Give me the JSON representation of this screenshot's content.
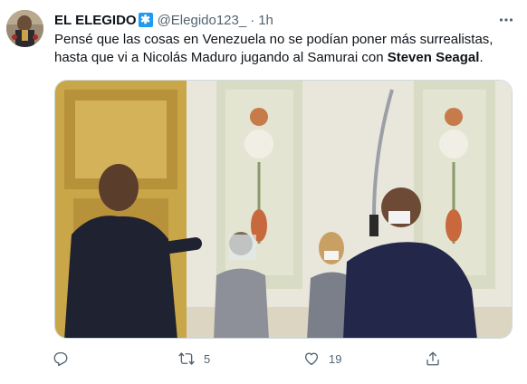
{
  "tweet": {
    "display_name": "EL ELEGIDO",
    "badge_glyph": "✱",
    "handle": "@Elegido123_",
    "separator": "·",
    "time": "1h",
    "text_part1": "Pensé que las cosas en Venezuela no se podían poner más surrealistas, hasta que vi a Nicolás Maduro jugando al Samurai con ",
    "text_bold": "Steven Seagal",
    "text_end": "."
  },
  "actions": {
    "reply_count": "",
    "retweet_count": "5",
    "like_count": "19",
    "icons": [
      "reply-icon",
      "retweet-icon",
      "like-icon",
      "share-icon"
    ]
  },
  "colors": {
    "accent": "#1d9bf0",
    "muted": "#536471",
    "text": "#0f1419"
  }
}
